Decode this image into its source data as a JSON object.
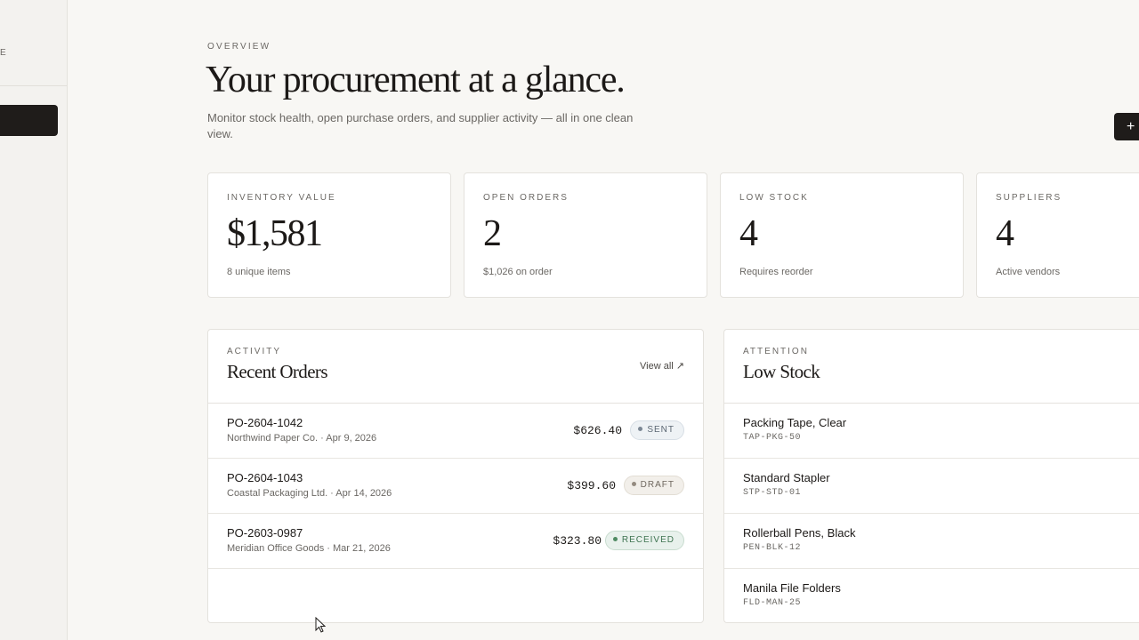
{
  "sidebar": {
    "label": "E"
  },
  "header": {
    "eyebrow": "OVERVIEW",
    "title": "Your procurement at a glance.",
    "subtitle": "Monitor stock health, open purchase orders, and supplier activity — all in one clean view.",
    "fab_label": "+"
  },
  "stats": [
    {
      "label": "INVENTORY VALUE",
      "value": "$1,581",
      "sub": "8 unique items"
    },
    {
      "label": "OPEN ORDERS",
      "value": "2",
      "sub": "$1,026 on order"
    },
    {
      "label": "LOW STOCK",
      "value": "4",
      "sub": "Requires reorder"
    },
    {
      "label": "SUPPLIERS",
      "value": "4",
      "sub": "Active vendors"
    }
  ],
  "orders": {
    "eyebrow": "ACTIVITY",
    "title": "Recent Orders",
    "view_all": "View all ↗",
    "rows": [
      {
        "id": "PO-2604-1042",
        "meta": "Northwind Paper Co. · Apr 9, 2026",
        "amount": "$626.40",
        "status": "SENT"
      },
      {
        "id": "PO-2604-1043",
        "meta": "Coastal Packaging Ltd. · Apr 14, 2026",
        "amount": "$399.60",
        "status": "DRAFT"
      },
      {
        "id": "PO-2603-0987",
        "meta": "Meridian Office Goods · Mar 21, 2026",
        "amount": "$323.80",
        "status": "RECEIVED"
      }
    ]
  },
  "low_stock": {
    "eyebrow": "ATTENTION",
    "title": "Low Stock",
    "rows": [
      {
        "name": "Packing Tape, Clear",
        "sku": "TAP-PKG-50"
      },
      {
        "name": "Standard Stapler",
        "sku": "STP-STD-01"
      },
      {
        "name": "Rollerball Pens, Black",
        "sku": "PEN-BLK-12"
      },
      {
        "name": "Manila File Folders",
        "sku": "FLD-MAN-25"
      }
    ]
  }
}
